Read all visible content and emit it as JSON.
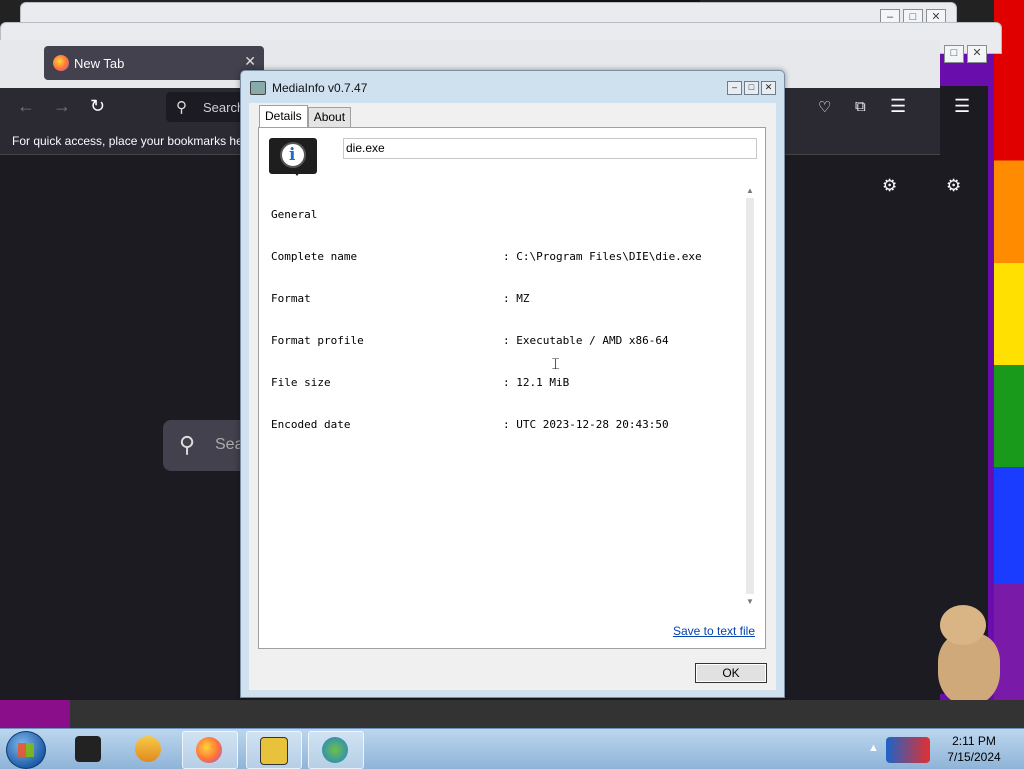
{
  "firefox": {
    "tab_title": "New Tab",
    "tab_close": "✕",
    "url_placeholder": "Search",
    "bookmarks_hint": "For quick access, place your bookmarks her",
    "content_search_placeholder": "Sea"
  },
  "mediainfo": {
    "title": "MediaInfo v0.7.47",
    "tabs": [
      "Details",
      "About"
    ],
    "active_tab": "Details",
    "file_name": "die.exe",
    "report": [
      {
        "key": "General",
        "value": ""
      },
      {
        "key": "Complete name",
        "value": ": C:\\Program Files\\DIE\\die.exe"
      },
      {
        "key": "Format",
        "value": ": MZ"
      },
      {
        "key": "Format profile",
        "value": ": Executable / AMD x86-64"
      },
      {
        "key": "File size",
        "value": ": 12.1 MiB"
      },
      {
        "key": "Encoded date",
        "value": ": UTC 2023-12-28 20:43:50"
      }
    ],
    "save_link": "Save to text file",
    "ok_label": "OK"
  },
  "taskbar": {
    "time": "2:11 PM",
    "date": "7/15/2024",
    "items": [
      "explorer-icon",
      "media-player-icon",
      "firefox-icon",
      "die-icon",
      "download-manager-icon"
    ]
  }
}
